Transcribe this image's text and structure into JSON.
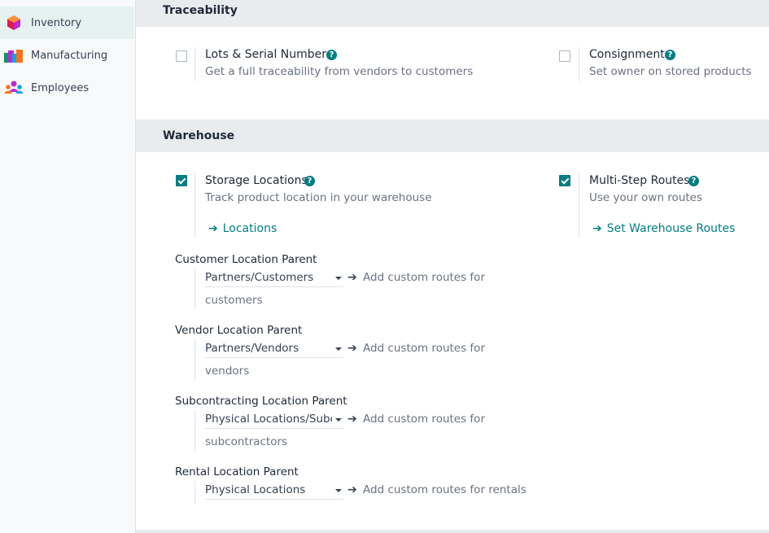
{
  "sidebar": {
    "items": [
      {
        "label": "Inventory",
        "icon": "inventory-icon",
        "active": true
      },
      {
        "label": "Manufacturing",
        "icon": "manufacturing-icon",
        "active": false
      },
      {
        "label": "Employees",
        "icon": "employees-icon",
        "active": false
      }
    ]
  },
  "traceability": {
    "title": "Traceability",
    "lots": {
      "title": "Lots & Serial Numbers",
      "help": "?",
      "desc": "Get a full traceability from vendors to customers",
      "checked": false
    },
    "consignment": {
      "title": "Consignment",
      "help": "?",
      "desc": "Set owner on stored products",
      "checked": false
    }
  },
  "warehouse": {
    "title": "Warehouse",
    "storage": {
      "title": "Storage Locations",
      "help": "?",
      "desc": "Track product location in your warehouse",
      "checked": true,
      "link_arrow": "➔",
      "link": "Locations"
    },
    "multistep": {
      "title": "Multi-Step Routes",
      "help": "?",
      "desc": "Use your own routes",
      "checked": true,
      "link_arrow": "➔",
      "link": "Set Warehouse Routes"
    },
    "parents": [
      {
        "label": "Customer Location Parent",
        "value": "Partners/Customers",
        "arrow": "➔",
        "route_line1": "Add custom routes for",
        "route_line2": "customers"
      },
      {
        "label": "Vendor Location Parent",
        "value": "Partners/Vendors",
        "arrow": "➔",
        "route_line1": "Add custom routes for",
        "route_line2": "vendors"
      },
      {
        "label": "Subcontracting Location Parent",
        "value": "Physical Locations/Subcontracting",
        "arrow": "➔",
        "route_line1": "Add custom routes for",
        "route_line2": "subcontractors"
      },
      {
        "label": "Rental Location Parent",
        "value": "Physical Locations",
        "arrow": "➔",
        "route_line1": "Add custom routes for rentals",
        "route_line2": ""
      }
    ]
  },
  "colors": {
    "accent": "#017e84",
    "section_bg": "#e9ecef",
    "active_bg": "#e6f2f2"
  }
}
